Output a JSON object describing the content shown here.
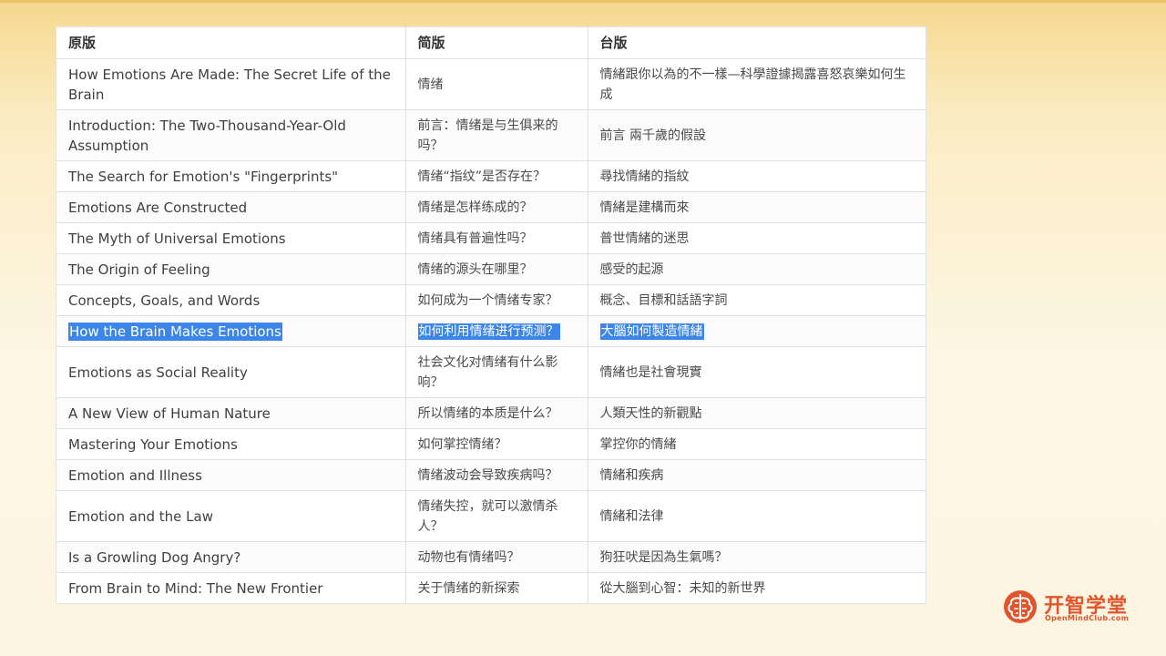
{
  "colors": {
    "accent": "#e2552c",
    "selection": "#3b86e8",
    "header_bg": "#ffffff",
    "border": "#dde2ea"
  },
  "table": {
    "headers": [
      "原版",
      "简版",
      "台版"
    ],
    "rows": [
      {
        "original": "How Emotions Are Made: The Secret Life of the Brain",
        "simplified": "情绪",
        "traditional": "情緒跟你以為的不一樣—科學證據揭露喜怒哀樂如何生成",
        "selected": false
      },
      {
        "original": "Introduction: The Two-Thousand-Year-Old Assumption",
        "simplified": "前言：情绪是与生俱来的吗？",
        "traditional": "前言 兩千歲的假設",
        "selected": false
      },
      {
        "original": "The Search for Emotion's \"Fingerprints\"",
        "simplified": "情绪“指纹”是否存在？",
        "traditional": "尋找情緒的指紋",
        "selected": false
      },
      {
        "original": "Emotions Are Constructed",
        "simplified": "情绪是怎样练成的？",
        "traditional": "情緒是建構而來",
        "selected": false
      },
      {
        "original": "The Myth of Universal Emotions",
        "simplified": "情绪具有普遍性吗？",
        "traditional": "普世情緒的迷思",
        "selected": false
      },
      {
        "original": "The Origin of Feeling",
        "simplified": "情绪的源头在哪里？",
        "traditional": "感受的起源",
        "selected": false
      },
      {
        "original": "Concepts, Goals, and Words",
        "simplified": "如何成为一个情绪专家？",
        "traditional": "概念、目標和話語字詞",
        "selected": false
      },
      {
        "original": "How the Brain Makes Emotions",
        "simplified": "如何利用情绪进行预测？",
        "traditional": "大腦如何製造情緒",
        "selected": true
      },
      {
        "original": "Emotions as Social Reality",
        "simplified": "社会文化对情绪有什么影响？",
        "traditional": "情緒也是社會現實",
        "selected": false
      },
      {
        "original": "A New View of Human Nature",
        "simplified": "所以情绪的本质是什么？",
        "traditional": "人類天性的新觀點",
        "selected": false
      },
      {
        "original": "Mastering Your Emotions",
        "simplified": "如何掌控情绪？",
        "traditional": "掌控你的情緒",
        "selected": false
      },
      {
        "original": "Emotion and Illness",
        "simplified": "情绪波动会导致疾病吗？",
        "traditional": "情緒和疾病",
        "selected": false
      },
      {
        "original": "Emotion and the Law",
        "simplified": "情绪失控，就可以激情杀人？",
        "traditional": "情緒和法律",
        "selected": false
      },
      {
        "original": "Is a Growling Dog Angry?",
        "simplified": "动物也有情绪吗？",
        "traditional": "狗狂吠是因為生氣嗎？",
        "selected": false
      },
      {
        "original": "From Brain to Mind: The New Frontier",
        "simplified": "关于情绪的新探索",
        "traditional": "從大腦到心智：未知的新世界",
        "selected": false
      }
    ]
  },
  "logo": {
    "title": "开智学堂",
    "subtitle": "OpenMindClub.com",
    "icon": "brain-icon"
  }
}
